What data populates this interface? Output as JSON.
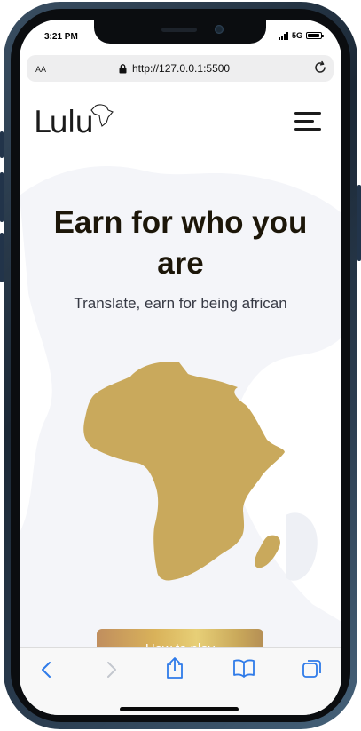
{
  "status": {
    "time": "3:21 PM",
    "network": "5G",
    "battery_level": 0.9
  },
  "browser": {
    "text_size_label": "AA",
    "url": "http://127.0.0.1:5500",
    "toolbar": [
      "back-icon",
      "forward-icon",
      "share-icon",
      "bookmarks-icon",
      "tabs-icon"
    ]
  },
  "site": {
    "logo_text": "Lulu",
    "hero": {
      "title": "Earn for who you are",
      "subtitle": "Translate, earn for being african"
    },
    "cta_label": "How to play"
  },
  "colors": {
    "accent_gold": "#c9a95c",
    "title": "#1c1609",
    "link_blue": "#2f7be9"
  }
}
